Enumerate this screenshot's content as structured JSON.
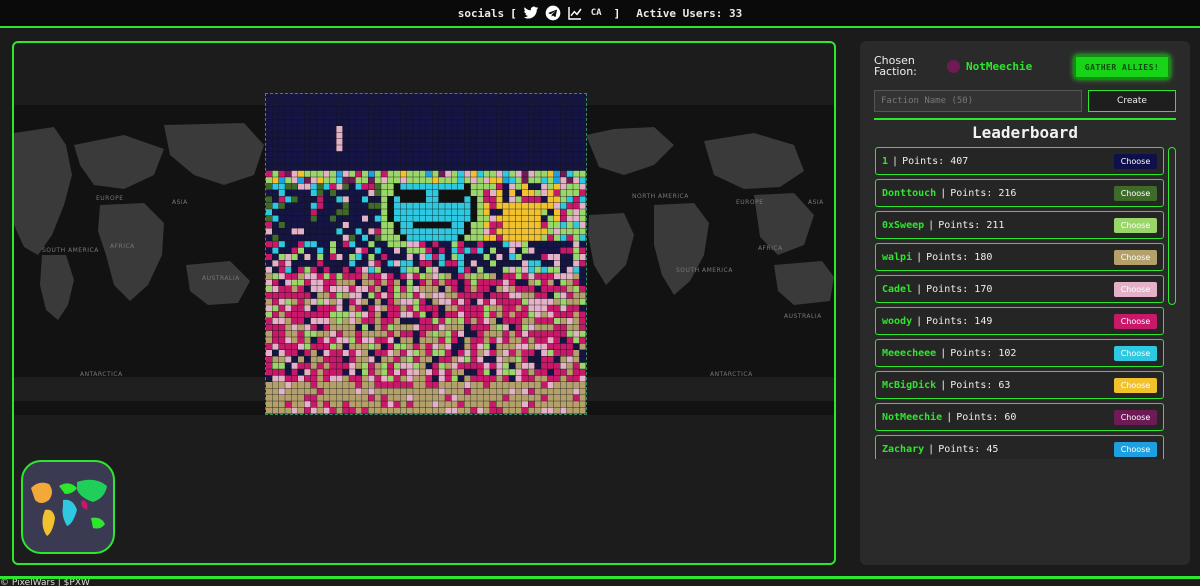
{
  "header": {
    "socials_label": "socials",
    "bracket_open": "[",
    "bracket_close": "]",
    "icons": [
      "twitter-icon",
      "telegram-icon",
      "chart-icon"
    ],
    "ca_label": "CA",
    "active_users_label": "Active Users: 33"
  },
  "map": {
    "continent_labels": [
      "SOUTH AMERICA",
      "EUROPE",
      "ASIA",
      "AFRICA",
      "AUSTRALIA",
      "ANTARCTICA",
      "NORTH AMERICA",
      "EUROPE",
      "ASIA",
      "AFRICA",
      "SOUTH AMERICA",
      "AUSTRALIA",
      "ANTARCTICA"
    ]
  },
  "sidebar": {
    "chosen_label_line1": "Chosen",
    "chosen_label_line2": "Faction:",
    "chosen_faction": "NotMeechie",
    "chosen_color": "#6d1a55",
    "gather_button": "GATHER ALLIES!",
    "faction_input_placeholder": "Faction Name (50)",
    "create_button": "Create",
    "leaderboard_title": "Leaderboard",
    "leaderboard": [
      {
        "name": "1",
        "points": "Points: 407",
        "button": "Choose",
        "color": "#0f0f4a"
      },
      {
        "name": "Donttouch",
        "points": "Points: 216",
        "button": "Choose",
        "color": "#3f6b2a"
      },
      {
        "name": "0xSweep",
        "points": "Points: 211",
        "button": "Choose",
        "color": "#9bd66b"
      },
      {
        "name": "walpi",
        "points": "Points: 180",
        "button": "Choose",
        "color": "#b3a06a"
      },
      {
        "name": "Cadel",
        "points": "Points: 170",
        "button": "Choose",
        "color": "#e3b2c8"
      },
      {
        "name": "woody",
        "points": "Points: 149",
        "button": "Choose",
        "color": "#c8186a"
      },
      {
        "name": "Meeecheee",
        "points": "Points: 102",
        "button": "Choose",
        "color": "#2ec9e0"
      },
      {
        "name": "McBigDick",
        "points": "Points: 63",
        "button": "Choose",
        "color": "#f2c12e"
      },
      {
        "name": "NotMeechie",
        "points": "Points: 60",
        "button": "Choose",
        "color": "#6d1a55"
      },
      {
        "name": "Zachary",
        "points": "Points: 45",
        "button": "Choose",
        "color": "#1ea0e0"
      }
    ]
  },
  "footer": {
    "text": "© PixelWars | $PXW"
  },
  "colors": {
    "accent": "#2ee62e",
    "panel": "#2a2a2a",
    "bg": "#1b1b1b"
  }
}
